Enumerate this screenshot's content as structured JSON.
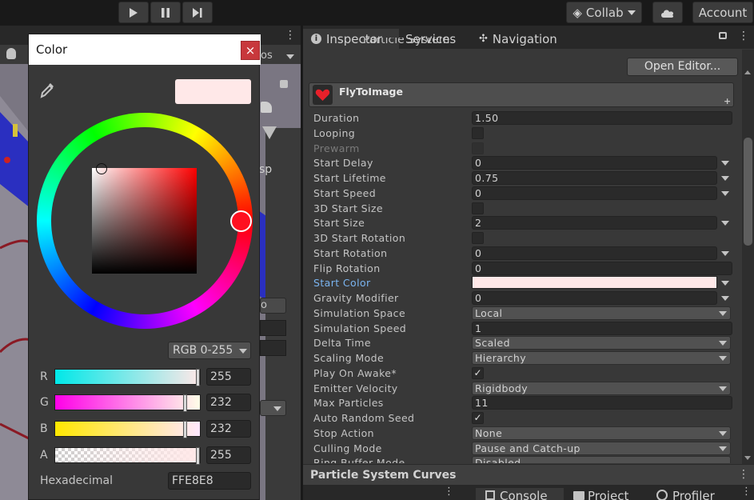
{
  "toolbar": {
    "collab_label": "Collab",
    "account_label": "Account"
  },
  "scene": {
    "partial_label": "sp"
  },
  "inspector": {
    "tabs": [
      {
        "label": "Inspector"
      },
      {
        "label": "Services"
      },
      {
        "label": "Navigation"
      }
    ],
    "header_partial": "Particle System",
    "open_editor_label": "Open Editor...",
    "component_name": "FlyToImage",
    "properties": [
      {
        "label": "Duration",
        "value": "1.50"
      },
      {
        "label": "Looping"
      },
      {
        "label": "Prewarm"
      },
      {
        "label": "Start Delay",
        "value": "0"
      },
      {
        "label": "Start Lifetime",
        "value": "0.75"
      },
      {
        "label": "Start Speed",
        "value": "0"
      },
      {
        "label": "3D Start Size"
      },
      {
        "label": "Start Size",
        "value": "2"
      },
      {
        "label": "3D Start Rotation"
      },
      {
        "label": "Start Rotation",
        "value": "0"
      },
      {
        "label": "Flip Rotation",
        "value": "0"
      },
      {
        "label": "Start Color"
      },
      {
        "label": "Gravity Modifier",
        "value": "0"
      },
      {
        "label": "Simulation Space",
        "value": "Local"
      },
      {
        "label": "Simulation Speed",
        "value": "1"
      },
      {
        "label": "Delta Time",
        "value": "Scaled"
      },
      {
        "label": "Scaling Mode",
        "value": "Hierarchy"
      },
      {
        "label": "Play On Awake*"
      },
      {
        "label": "Emitter Velocity",
        "value": "Rigidbody"
      },
      {
        "label": "Max Particles",
        "value": "11"
      },
      {
        "label": "Auto Random Seed"
      },
      {
        "label": "Stop Action",
        "value": "None"
      },
      {
        "label": "Culling Mode",
        "value": "Pause and Catch-up"
      },
      {
        "label": "Ring Buffer Mode",
        "value": "Disabled"
      }
    ],
    "start_color_hex": "#FFE8E8",
    "curves_label": "Particle System Curves"
  },
  "bottom_tabs": [
    {
      "label": "Console"
    },
    {
      "label": "Project"
    },
    {
      "label": "Profiler"
    }
  ],
  "color_picker": {
    "title": "Color",
    "close_symbol": "×",
    "preview_color": "#FFE8E8",
    "mode_label": "RGB 0-255",
    "channels": [
      {
        "label": "R",
        "value": "255",
        "fraction": 1.0
      },
      {
        "label": "G",
        "value": "232",
        "fraction": 0.91
      },
      {
        "label": "B",
        "value": "232",
        "fraction": 0.91
      },
      {
        "label": "A",
        "value": "255",
        "fraction": 1.0
      }
    ],
    "hex_label": "Hexadecimal",
    "hex_value": "FFE8E8"
  }
}
